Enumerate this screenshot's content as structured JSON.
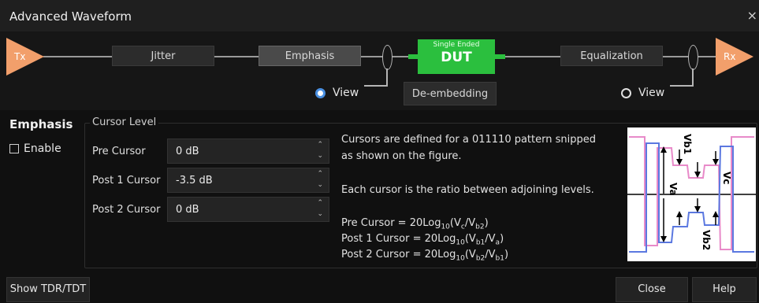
{
  "window": {
    "title": "Advanced Waveform",
    "close_glyph": "×"
  },
  "chain": {
    "tx_label": "Tx",
    "rx_label": "Rx",
    "jitter_label": "Jitter",
    "emphasis_label": "Emphasis",
    "dut_subtitle": "Single Ended",
    "dut_label": "DUT",
    "equalization_label": "Equalization",
    "deembedding_label": "De-embedding",
    "view_left_label": "View",
    "view_right_label": "View",
    "view_selected": "left",
    "accent_color": "#2bbf3e",
    "triangle_color": "#f29f6b"
  },
  "emphasis": {
    "title": "Emphasis",
    "enable_label": "Enable",
    "enable_checked": false,
    "group_title": "Cursor Level",
    "rows": [
      {
        "label": "Pre Cursor",
        "value": "0 dB"
      },
      {
        "label": "Post 1 Cursor",
        "value": "-3.5 dB"
      },
      {
        "label": "Post 2 Cursor",
        "value": "0 dB"
      }
    ],
    "description_1a": "Cursors are defined for a 011110 pattern snipped",
    "description_1b": "as shown on the figure.",
    "description_2": "Each cursor is the ratio between adjoining levels.",
    "formulas": [
      {
        "prefix": "Pre Cursor = 20Log",
        "base": "10",
        "arg": "(V",
        "s1": "c",
        "mid": "/V",
        "s2": "b2",
        "end": ")"
      },
      {
        "prefix": "Post 1 Cursor = 20Log",
        "base": "10",
        "arg": "(V",
        "s1": "b1",
        "mid": "/V",
        "s2": "a",
        "end": ")"
      },
      {
        "prefix": "Post 2 Cursor = 20Log",
        "base": "10",
        "arg": "(V",
        "s1": "b2",
        "mid": "/V",
        "s2": "b1",
        "end": ")"
      }
    ],
    "figure_labels": {
      "va": "Va",
      "vb1": "Vb1",
      "vc": "Vc",
      "vb2": "Vb2"
    }
  },
  "footer": {
    "show_tdr_label": "Show TDR/TDT",
    "close_label": "Close",
    "help_label": "Help"
  }
}
